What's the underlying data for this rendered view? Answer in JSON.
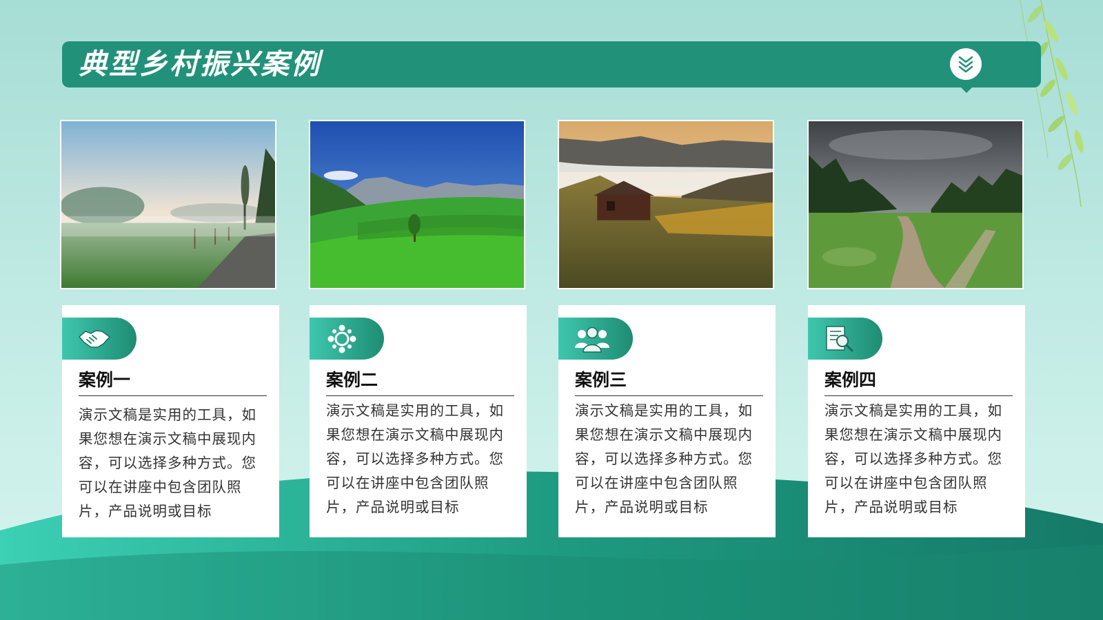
{
  "title": "典型乡村振兴案例",
  "cards": [
    {
      "title": "案例一",
      "icon": "handshake-icon",
      "text": "演示文稿是实用的工具，如果您想在演示文稿中展现内容，可以选择多种方式。您可以在讲座中包含团队照片，产品说明或目标"
    },
    {
      "title": "案例二",
      "icon": "team-circle-icon",
      "text": "演示文稿是实用的工具，如果您想在演示文稿中展现内容，可以选择多种方式。您可以在讲座中包含团队照片，产品说明或目标"
    },
    {
      "title": "案例三",
      "icon": "people-group-icon",
      "text": "演示文稿是实用的工具，如果您想在演示文稿中展现内容，可以选择多种方式。您可以在讲座中包含团队照片，产品说明或目标"
    },
    {
      "title": "案例四",
      "icon": "document-search-icon",
      "text": "演示文稿是实用的工具，如果您想在演示文稿中展现内容，可以选择多种方式。您可以在讲座中包含团队照片，产品说明或目标"
    }
  ],
  "photos": [
    "misty-meadow-photo",
    "green-mountain-valley-photo",
    "mountain-cabin-photo",
    "dirt-road-forest-photo"
  ],
  "colors": {
    "accent": "#22917a",
    "accent_light": "#3ec7ae",
    "background": "#bfe9e3",
    "wave": "#1e8c72"
  }
}
